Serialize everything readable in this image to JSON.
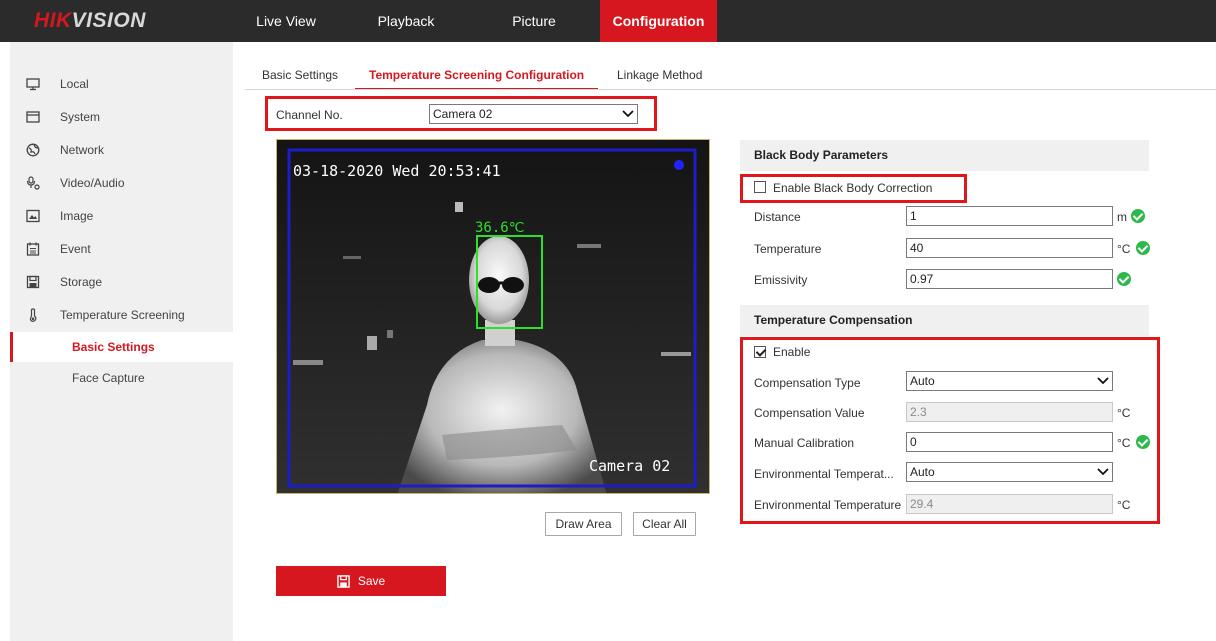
{
  "brand": {
    "red": "HIK",
    "white": "VISION"
  },
  "nav": {
    "live_view": "Live View",
    "playback": "Playback",
    "picture": "Picture",
    "configuration": "Configuration"
  },
  "sidebar": {
    "items": [
      {
        "label": "Local",
        "icon": "monitor-icon"
      },
      {
        "label": "System",
        "icon": "system-icon"
      },
      {
        "label": "Network",
        "icon": "globe-icon"
      },
      {
        "label": "Video/Audio",
        "icon": "video-audio-icon"
      },
      {
        "label": "Image",
        "icon": "image-icon"
      },
      {
        "label": "Event",
        "icon": "calendar-icon"
      },
      {
        "label": "Storage",
        "icon": "disk-icon"
      },
      {
        "label": "Temperature Screening",
        "icon": "thermometer-icon"
      }
    ],
    "sub_items": [
      {
        "label": "Basic Settings",
        "active": true
      },
      {
        "label": "Face Capture",
        "active": false
      }
    ]
  },
  "tabs": {
    "basic": "Basic Settings",
    "temperature": "Temperature Screening Configuration",
    "linkage": "Linkage Method"
  },
  "channel": {
    "label": "Channel No.",
    "value": "Camera 02"
  },
  "video": {
    "osd_datetime": "03-18-2020 Wed 20:53:41",
    "osd_camera": "Camera 02",
    "temperature_tag": "36.6℃"
  },
  "buttons": {
    "draw_area": "Draw Area",
    "clear_all": "Clear All",
    "save": "Save"
  },
  "black_body": {
    "title": "Black Body Parameters",
    "enable_label": "Enable Black Body Correction",
    "enabled": false,
    "distance_label": "Distance",
    "distance_value": "1",
    "distance_unit": "m",
    "temperature_label": "Temperature",
    "temperature_value": "40",
    "temperature_unit": "°C",
    "emissivity_label": "Emissivity",
    "emissivity_value": "0.97"
  },
  "compensation": {
    "title": "Temperature Compensation",
    "enable_label": "Enable",
    "enabled": true,
    "type_label": "Compensation Type",
    "type_value": "Auto",
    "value_label": "Compensation Value",
    "value_value": "2.3",
    "value_unit": "°C",
    "manual_label": "Manual Calibration",
    "manual_value": "0",
    "manual_unit": "°C",
    "env_mode_label": "Environmental Temperat...",
    "env_mode_value": "Auto",
    "env_temp_label": "Environmental Temperature",
    "env_temp_value": "29.4",
    "env_temp_unit": "°C"
  },
  "colors": {
    "accent": "#d7171f",
    "ok": "#2db84b",
    "nav_bg": "#2b2b2b"
  }
}
